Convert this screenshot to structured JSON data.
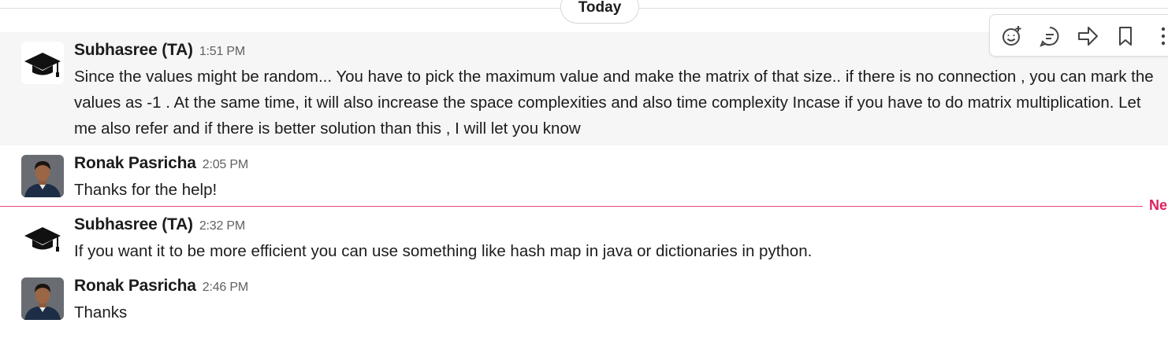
{
  "day_divider": {
    "label": "Today"
  },
  "messages": [
    {
      "author": "Subhasree (TA)",
      "time": "1:51 PM",
      "avatar_icon": "graduation-cap-icon",
      "text": "Since the values might be random... You have to pick the maximum value and make the matrix of that size.. if there is no connection , you can mark the values as -1 . At the same time, it will also increase the space complexities and also time complexity Incase if you have to do matrix multiplication. Let me also refer and if there is better solution than this , I will let you know"
    },
    {
      "author": "Ronak Pasricha",
      "time": "2:05 PM",
      "avatar_icon": "user-photo-avatar",
      "text": "Thanks for the help!"
    },
    {
      "author": "Subhasree (TA)",
      "time": "2:32 PM",
      "avatar_icon": "graduation-cap-icon",
      "text": "If you want it to be more efficient you can use something like hash map in java or dictionaries in python."
    },
    {
      "author": "Ronak Pasricha",
      "time": "2:46 PM",
      "avatar_icon": "user-photo-avatar",
      "text": "Thanks"
    }
  ],
  "new_divider": {
    "label": "Ne",
    "color": "#e01e5a"
  },
  "toolbar": {
    "actions": [
      "add-reaction-icon",
      "reply-in-thread-icon",
      "forward-icon",
      "bookmark-icon",
      "more-actions-icon"
    ]
  },
  "colors": {
    "hover_bg": "#f6f6f6",
    "text": "#1d1c1d",
    "timestamp": "#616061"
  }
}
